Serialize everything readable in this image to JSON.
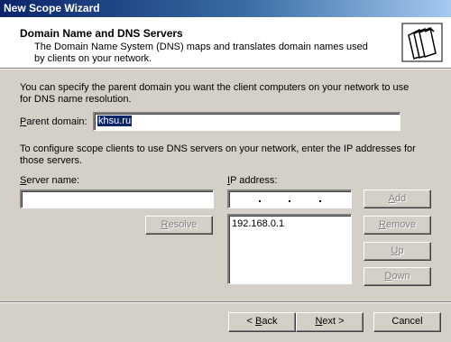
{
  "window": {
    "title": "New Scope Wizard"
  },
  "header": {
    "title": "Domain Name and DNS Servers",
    "description": "The Domain Name System (DNS) maps and translates domain names used by clients on your network.",
    "icon": "folders-icon"
  },
  "parent_domain": {
    "intro": "You can specify the parent domain you want the client computers on your network to use for DNS name resolution.",
    "label_prefix": "",
    "label_accel": "P",
    "label_rest": "arent domain:",
    "value": "khsu.ru"
  },
  "dns": {
    "intro": "To configure scope clients to use DNS servers on your network, enter the IP addresses for those servers.",
    "server_label_accel": "S",
    "server_label_rest": "erver name:",
    "server_value": "",
    "ip_label_accel": "I",
    "ip_label_rest": "P address:",
    "ip_list": [
      "192.168.0.1"
    ]
  },
  "buttons": {
    "add": {
      "accel": "A",
      "rest": "dd"
    },
    "resolve": {
      "accel": "R",
      "rest": "esolve"
    },
    "remove": {
      "accel": "R",
      "rest": "emove"
    },
    "up": {
      "accel": "U",
      "rest": "p"
    },
    "down": {
      "accel": "D",
      "rest": "own"
    }
  },
  "footer": {
    "back": {
      "prefix": "< ",
      "accel": "B",
      "rest": "ack"
    },
    "next": {
      "accel": "N",
      "rest": "ext >"
    },
    "cancel": "Cancel"
  }
}
